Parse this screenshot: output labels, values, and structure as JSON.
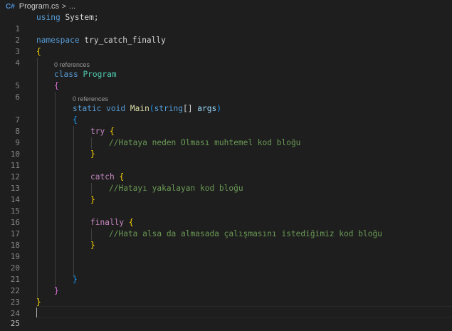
{
  "breadcrumb": {
    "lang_icon": "C#",
    "file": "Program.cs",
    "sep": ">",
    "more": "..."
  },
  "codelens": {
    "class_refs": "0 references",
    "method_refs": "0 references"
  },
  "line_numbers": [
    "1",
    "2",
    "3",
    "4",
    "5",
    "6",
    "7",
    "8",
    "9",
    "10",
    "11",
    "12",
    "13",
    "14",
    "15",
    "16",
    "17",
    "18",
    "19",
    "20",
    "21",
    "22",
    "23",
    "24",
    "25"
  ],
  "code": {
    "l1_using": "using",
    "l1_ns": "System",
    "l1_semi": ";",
    "l3_kw": "namespace",
    "l3_name": "try_catch_finally",
    "l4_brace": "{",
    "l5_kw": "class",
    "l5_name": "Program",
    "l6_brace": "{",
    "l7_static": "static",
    "l7_void": "void",
    "l7_name": "Main",
    "l7_paren_open": "(",
    "l7_type": "string",
    "l7_arr": "[]",
    "l7_param": "args",
    "l7_paren_close": ")",
    "l8_brace": "{",
    "l9_kw": "try",
    "l9_brace": "{",
    "l10_comment": "//Hataya neden Olması muhtemel kod bloğu",
    "l11_brace": "}",
    "l13_kw": "catch",
    "l13_brace": "{",
    "l14_comment": "//Hatayı yakalayan kod bloğu",
    "l15_brace": "}",
    "l17_kw": "finally",
    "l17_brace": "{",
    "l18_comment": "//Hata alsa da almasada çalışmasını istediğimiz kod bloğu",
    "l19_brace": "}",
    "l22_brace": "}",
    "l23_brace": "}",
    "l24_brace": "}"
  },
  "colors": {
    "background": "#1e1e1e",
    "keyword": "#569cd6",
    "control_keyword": "#c586c0",
    "type": "#4ec9b0",
    "function": "#dcdcaa",
    "parameter": "#9cdcfe",
    "comment": "#6a9955",
    "bracket_level1": "#ffd700",
    "bracket_level2": "#da70d6",
    "bracket_level3": "#179fff"
  }
}
